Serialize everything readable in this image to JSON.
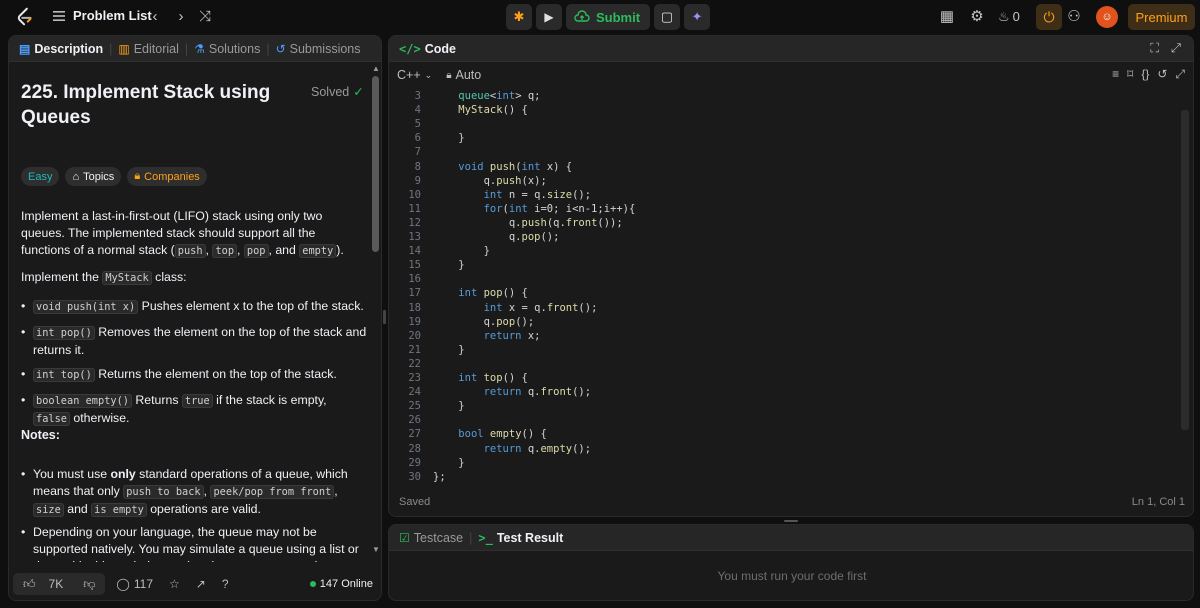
{
  "nav": {
    "problem_list": "Problem List",
    "submit_label": "Submit",
    "streak_count": "0",
    "premium_label": "Premium"
  },
  "left_tabs": {
    "description": "Description",
    "editorial": "Editorial",
    "solutions": "Solutions",
    "submissions": "Submissions"
  },
  "problem": {
    "title": "225. Implement Stack using Queues",
    "status": "Solved",
    "difficulty": "Easy",
    "topics_label": "Topics",
    "companies_label": "Companies",
    "intro_1": "Implement a last-in-first-out (LIFO) stack using only two queues. The implemented stack should support all the functions of a normal stack (",
    "intro_codes": [
      "push",
      "top",
      "pop",
      "empty"
    ],
    "intro_2": "Implement the ",
    "class_name": "MyStack",
    "intro_2b": " class:",
    "methods": [
      {
        "code": "void push(int x)",
        "text": " Pushes element x to the top of the stack."
      },
      {
        "code": "int pop()",
        "text": " Removes the element on the top of the stack and returns it."
      },
      {
        "code": "int top()",
        "text": " Returns the element on the top of the stack."
      },
      {
        "code": "boolean empty()",
        "text": " Returns ",
        "code2": "true",
        "text2": " if the stack is empty, ",
        "code3": "false",
        "text3": " otherwise."
      }
    ],
    "notes_label": "Notes:",
    "note1": {
      "pre": "You must use ",
      "bold": "only",
      "post": " standard operations of a queue, which means that only ",
      "codes": [
        "push to back",
        "peek/pop from front",
        "size"
      ],
      "and": "and ",
      "code_last": "is empty",
      "tail": " operations are valid."
    },
    "note2": "Depending on your language, the queue may not be supported natively. You may simulate a queue using a list or deque (double-ended queue) as long as you use only a queue's standard operations."
  },
  "footer": {
    "likes": "7K",
    "comments": "117",
    "online": "147 Online"
  },
  "code_panel": {
    "title": "Code",
    "language": "C++",
    "mode": "Auto",
    "saved": "Saved",
    "cursor": "Ln 1, Col 1"
  },
  "code_lines": [
    {
      "n": "3",
      "t": "    queue<int> q;"
    },
    {
      "n": "4",
      "t": "    MyStack() {"
    },
    {
      "n": "5",
      "t": ""
    },
    {
      "n": "6",
      "t": "    }"
    },
    {
      "n": "7",
      "t": ""
    },
    {
      "n": "8",
      "t": "    void push(int x) {"
    },
    {
      "n": "9",
      "t": "        q.push(x);"
    },
    {
      "n": "10",
      "t": "        int n = q.size();"
    },
    {
      "n": "11",
      "t": "        for(int i=0; i<n-1;i++){"
    },
    {
      "n": "12",
      "t": "            q.push(q.front());"
    },
    {
      "n": "13",
      "t": "            q.pop();"
    },
    {
      "n": "14",
      "t": "        }"
    },
    {
      "n": "15",
      "t": "    }"
    },
    {
      "n": "16",
      "t": ""
    },
    {
      "n": "17",
      "t": "    int pop() {"
    },
    {
      "n": "18",
      "t": "        int x = q.front();"
    },
    {
      "n": "19",
      "t": "        q.pop();"
    },
    {
      "n": "20",
      "t": "        return x;"
    },
    {
      "n": "21",
      "t": "    }"
    },
    {
      "n": "22",
      "t": ""
    },
    {
      "n": "23",
      "t": "    int top() {"
    },
    {
      "n": "24",
      "t": "        return q.front();"
    },
    {
      "n": "25",
      "t": "    }"
    },
    {
      "n": "26",
      "t": ""
    },
    {
      "n": "27",
      "t": "    bool empty() {"
    },
    {
      "n": "28",
      "t": "        return q.empty();"
    },
    {
      "n": "29",
      "t": "    }"
    },
    {
      "n": "30",
      "t": "};"
    }
  ],
  "result_panel": {
    "testcase": "Testcase",
    "test_result": "Test Result",
    "message": "You must run your code first"
  },
  "colors": {
    "accent": "#ffa116",
    "success": "#2cbb5d",
    "easy": "#1cbaba"
  }
}
